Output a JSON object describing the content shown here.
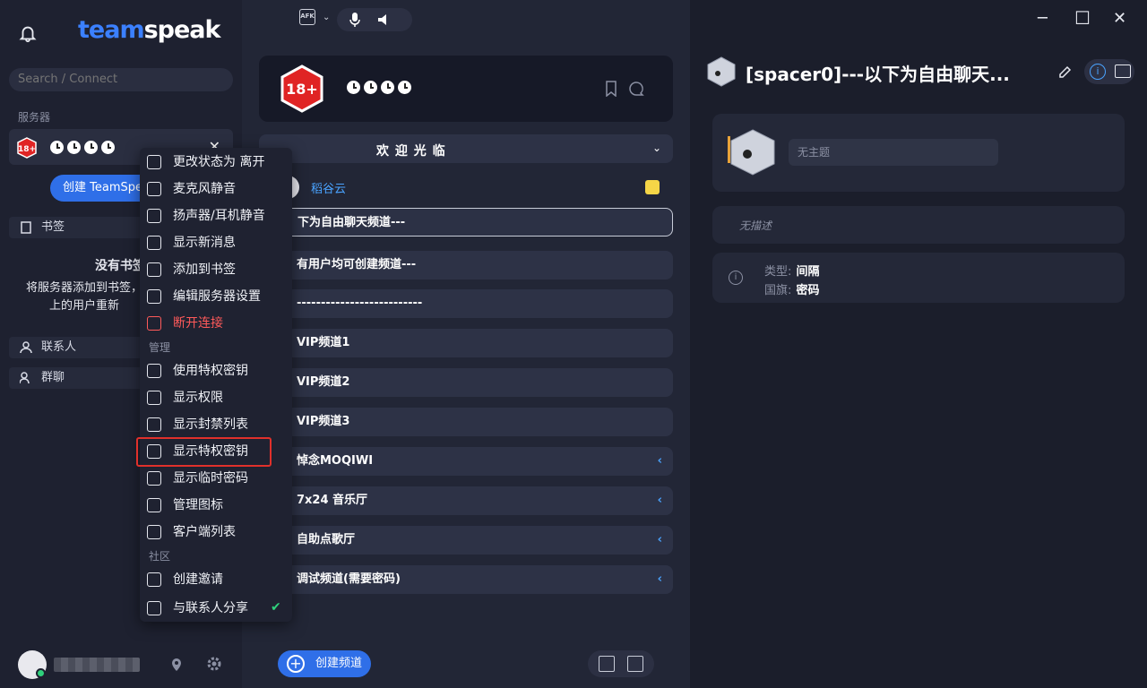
{
  "app": {
    "logo_part1": "team",
    "logo_part2": "speak"
  },
  "sidebar": {
    "search_placeholder": "Search / Connect",
    "servers_label": "服务器",
    "server_badge": "18+",
    "create_button": "创建 TeamSpeak",
    "bookmarks_tab": "书签",
    "empty_title": "没有书签",
    "empty_desc_line1": "将服务器添加到书签，",
    "empty_desc_line2": "上的用户重新",
    "contacts_tab": "联系人",
    "groups_tab": "群聊"
  },
  "context_menu": {
    "items": [
      {
        "label": "更改状态为 离开",
        "icon": "afk-icon"
      },
      {
        "label": "麦克风静音",
        "icon": "microphone-icon"
      },
      {
        "label": "扬声器/耳机静音",
        "icon": "speaker-icon"
      },
      {
        "label": "显示新消息",
        "icon": "info-icon"
      },
      {
        "label": "添加到书签",
        "icon": "bookmark-icon"
      },
      {
        "label": "编辑服务器设置",
        "icon": "edit-icon"
      },
      {
        "label": "断开连接",
        "icon": "close-icon"
      }
    ],
    "admin_label": "管理",
    "admin_items": [
      {
        "label": "使用特权密钥",
        "icon": "key-icon"
      },
      {
        "label": "显示权限",
        "icon": "permissions-icon"
      },
      {
        "label": "显示封禁列表",
        "icon": "ban-hammer-icon"
      },
      {
        "label": "显示特权密钥",
        "icon": "key-icon"
      },
      {
        "label": "显示临时密码",
        "icon": "unlock-icon"
      },
      {
        "label": "管理图标",
        "icon": "image-icon"
      },
      {
        "label": "客户端列表",
        "icon": "users-icon"
      }
    ],
    "community_label": "社区",
    "community_items": [
      {
        "label": "创建邀请",
        "icon": "share-icon"
      },
      {
        "label": "与联系人分享",
        "icon": "location-pin-icon"
      }
    ]
  },
  "server": {
    "welcome": "欢 迎 光 临",
    "user_name": "稻谷云",
    "channels": [
      {
        "name": "下为自由聊天频道---",
        "selected": true
      },
      {
        "name": "有用户均可创建频道---"
      },
      {
        "name": "--------------------------"
      },
      {
        "name": "VIP频道1"
      },
      {
        "name": "VIP频道2"
      },
      {
        "name": "VIP频道3"
      },
      {
        "name": "悼念MOQIWI",
        "chev": "‹"
      },
      {
        "name": "7x24 音乐厅",
        "chev": "‹"
      },
      {
        "name": "自助点歌厅",
        "chev": "‹"
      },
      {
        "name": "调试频道(需要密码)",
        "chev": "‹"
      }
    ],
    "create_channel": "创建频道"
  },
  "right_panel": {
    "title": "[spacer0]---以下为自由聊天...",
    "topic_placeholder": "无主题",
    "description": "无描述",
    "type_label": "类型:",
    "type_value": "间隔",
    "flag_label": "国旗:",
    "flag_value": "密码"
  },
  "colors": {
    "accent": "#2f6fe8",
    "danger": "#ff5a5a",
    "highlight_box": "#e0302b",
    "link": "#4aa3ff"
  }
}
